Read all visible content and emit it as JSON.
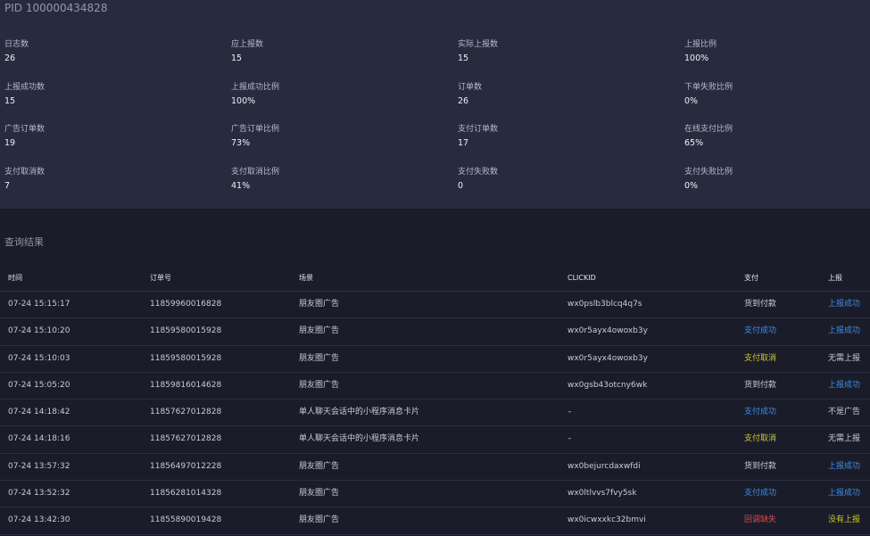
{
  "header": {
    "pid": "PID 100000434828"
  },
  "stats": [
    {
      "label": "日志数",
      "value": "26"
    },
    {
      "label": "应上报数",
      "value": "15"
    },
    {
      "label": "实际上报数",
      "value": "15"
    },
    {
      "label": "上报比例",
      "value": "100%"
    },
    {
      "label": "上报成功数",
      "value": "15"
    },
    {
      "label": "上报成功比例",
      "value": "100%"
    },
    {
      "label": "订单数",
      "value": "26"
    },
    {
      "label": "下单失败比例",
      "value": "0%"
    },
    {
      "label": "广告订单数",
      "value": "19"
    },
    {
      "label": "广告订单比例",
      "value": "73%"
    },
    {
      "label": "支付订单数",
      "value": "17"
    },
    {
      "label": "在线支付比例",
      "value": "65%"
    },
    {
      "label": "支付取消数",
      "value": "7"
    },
    {
      "label": "支付取消比例",
      "value": "41%"
    },
    {
      "label": "支付失败数",
      "value": "0"
    },
    {
      "label": "支付失败比例",
      "value": "0%"
    }
  ],
  "results": {
    "title": "查询结果",
    "columns": {
      "time": "时间",
      "order": "订单号",
      "scene": "场景",
      "clickid": "CLICKID",
      "pay": "支付",
      "report": "上报"
    },
    "status_colors": {
      "neutral": "#c9cbd8",
      "success": "#3a8ee6",
      "warning": "#c8c929",
      "error": "#e54848"
    },
    "rows": [
      {
        "time": "07-24 15:15:17",
        "order": "11859960016828",
        "scene": "朋友圈广告",
        "clickid": "wx0pslb3blcq4q7s",
        "pay": "货到付款",
        "pay_status": "neutral",
        "report": "上报成功",
        "report_status": "success"
      },
      {
        "time": "07-24 15:10:20",
        "order": "11859580015928",
        "scene": "朋友圈广告",
        "clickid": "wx0r5ayx4owoxb3y",
        "pay": "支付成功",
        "pay_status": "success",
        "report": "上报成功",
        "report_status": "success"
      },
      {
        "time": "07-24 15:10:03",
        "order": "11859580015928",
        "scene": "朋友圈广告",
        "clickid": "wx0r5ayx4owoxb3y",
        "pay": "支付取消",
        "pay_status": "warning",
        "report": "无需上报",
        "report_status": "neutral"
      },
      {
        "time": "07-24 15:05:20",
        "order": "11859816014628",
        "scene": "朋友圈广告",
        "clickid": "wx0gsb43otcny6wk",
        "pay": "货到付款",
        "pay_status": "neutral",
        "report": "上报成功",
        "report_status": "success"
      },
      {
        "time": "07-24 14:18:42",
        "order": "11857627012828",
        "scene": "单人聊天会话中的小程序消息卡片",
        "clickid": "–",
        "pay": "支付成功",
        "pay_status": "success",
        "report": "不是广告",
        "report_status": "neutral"
      },
      {
        "time": "07-24 14:18:16",
        "order": "11857627012828",
        "scene": "单人聊天会话中的小程序消息卡片",
        "clickid": "–",
        "pay": "支付取消",
        "pay_status": "warning",
        "report": "无需上报",
        "report_status": "neutral"
      },
      {
        "time": "07-24 13:57:32",
        "order": "11856497012228",
        "scene": "朋友圈广告",
        "clickid": "wx0bejurcdaxwfdi",
        "pay": "货到付款",
        "pay_status": "neutral",
        "report": "上报成功",
        "report_status": "success"
      },
      {
        "time": "07-24 13:52:32",
        "order": "11856281014328",
        "scene": "朋友圈广告",
        "clickid": "wx0ltlvvs7fvy5sk",
        "pay": "支付成功",
        "pay_status": "success",
        "report": "上报成功",
        "report_status": "success"
      },
      {
        "time": "07-24 13:42:30",
        "order": "11855890019428",
        "scene": "朋友圈广告",
        "clickid": "wx0icwxxkc32bmvi",
        "pay": "回调缺失",
        "pay_status": "error",
        "report": "没有上报",
        "report_status": "warning"
      }
    ]
  }
}
